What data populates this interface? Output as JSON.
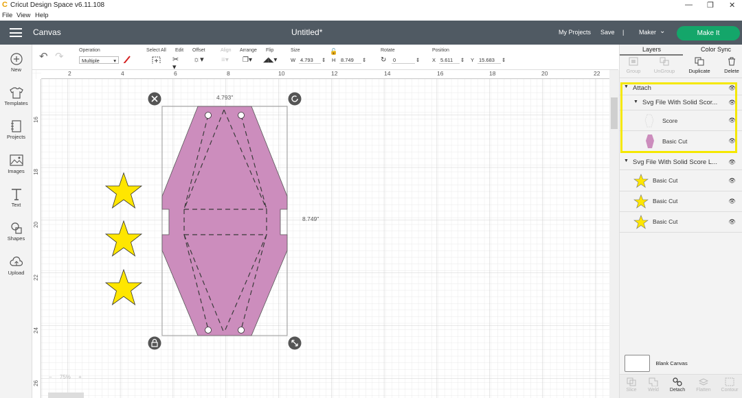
{
  "window": {
    "app_icon": "cricut-c-icon",
    "title": "Cricut Design Space  v6.11.108"
  },
  "menu": [
    "File",
    "View",
    "Help"
  ],
  "header": {
    "section": "Canvas",
    "doc_title": "Untitled*",
    "my_projects": "My Projects",
    "save": "Save",
    "separator": "|",
    "machine": "Maker",
    "make_it": "Make It"
  },
  "toolbar": {
    "operation_label": "Operation",
    "operation_value": "Multiple",
    "select_all": "Select All",
    "edit": "Edit",
    "offset": "Offset",
    "align": "Align",
    "arrange": "Arrange",
    "flip": "Flip",
    "size_label": "Size",
    "w_label": "W",
    "w_value": "4.793",
    "h_label": "H",
    "h_value": "8.749",
    "rotate_label": "Rotate",
    "rotate_value": "0",
    "position_label": "Position",
    "x_label": "X",
    "x_value": "5.611",
    "y_label": "Y",
    "y_value": "15.683"
  },
  "leftbar": [
    "New",
    "Templates",
    "Projects",
    "Images",
    "Text",
    "Shapes",
    "Upload"
  ],
  "ruler": {
    "top": [
      "2",
      "4",
      "6",
      "8",
      "10",
      "12",
      "14",
      "16",
      "18",
      "20",
      "22"
    ],
    "left": [
      "16",
      "18",
      "20",
      "22",
      "24",
      "26"
    ]
  },
  "selection": {
    "width_label": "4.793\"",
    "height_label": "8.749\"",
    "fill_color": "#cc8dbd",
    "star_color": "#ffe600"
  },
  "zoom": {
    "value": "75%",
    "minus": "−",
    "plus": "+"
  },
  "panel": {
    "tabs": [
      "Layers",
      "Color Sync"
    ],
    "tools": [
      "Group",
      "UnGroup",
      "Duplicate",
      "Delete"
    ],
    "layers": {
      "attach": "Attach",
      "group1": "Svg File With Solid Scor...",
      "score": "Score",
      "basic_cut_1": "Basic Cut",
      "group2": "Svg File With Solid Score L...",
      "star_cut_1": "Basic Cut",
      "star_cut_2": "Basic Cut",
      "star_cut_3": "Basic Cut"
    },
    "blank_canvas": "Blank Canvas",
    "bottom_tools": [
      "Slice",
      "Weld",
      "Detach",
      "Flatten",
      "Contour"
    ]
  }
}
